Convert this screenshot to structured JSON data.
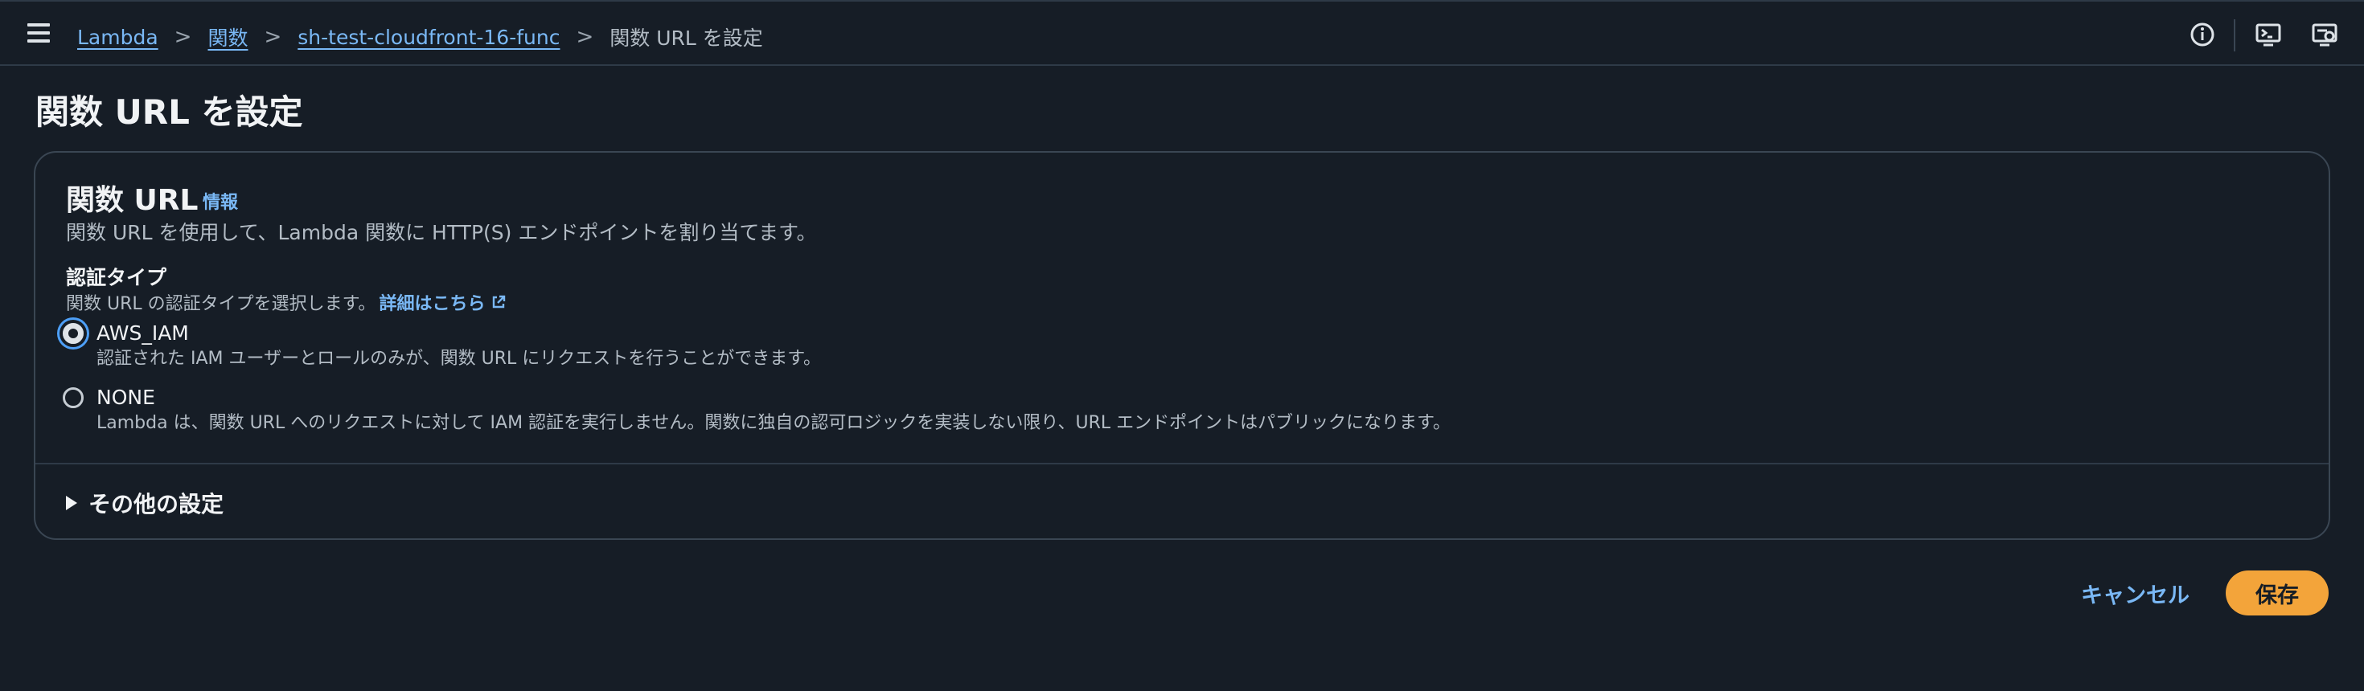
{
  "breadcrumb": {
    "items": [
      "Lambda",
      "関数",
      "sh-test-cloudfront-16-func"
    ],
    "current": "関数 URL を設定",
    "separator": ">"
  },
  "header_icons": [
    "info-circle-icon",
    "cloudshell-icon",
    "preferences-icon"
  ],
  "page": {
    "title": "関数 URL を設定"
  },
  "panel": {
    "title": "関数 URL",
    "info_link": "情報",
    "description": "関数 URL を使用して、Lambda 関数に HTTP(S) エンドポイントを割り当てます。",
    "auth": {
      "label": "認証タイプ",
      "description": "関数 URL の認証タイプを選択します。",
      "learn_more": "詳細はこちら",
      "options": [
        {
          "label": "AWS_IAM",
          "description": "認証された IAM ユーザーとロールのみが、関数 URL にリクエストを行うことができます。",
          "selected": true
        },
        {
          "label": "NONE",
          "description": "Lambda は、関数 URL へのリクエストに対して IAM 認証を実行しません。関数に独自の認可ロジックを実装しない限り、URL エンドポイントはパブリックになります。",
          "selected": false
        }
      ]
    },
    "additional_settings": "その他の設定"
  },
  "actions": {
    "cancel": "キャンセル",
    "save": "保存"
  },
  "colors": {
    "background": "#161d26",
    "link": "#7ab8f5",
    "primary_button": "#f3a43a",
    "radio_focus": "#4d9ff7"
  }
}
